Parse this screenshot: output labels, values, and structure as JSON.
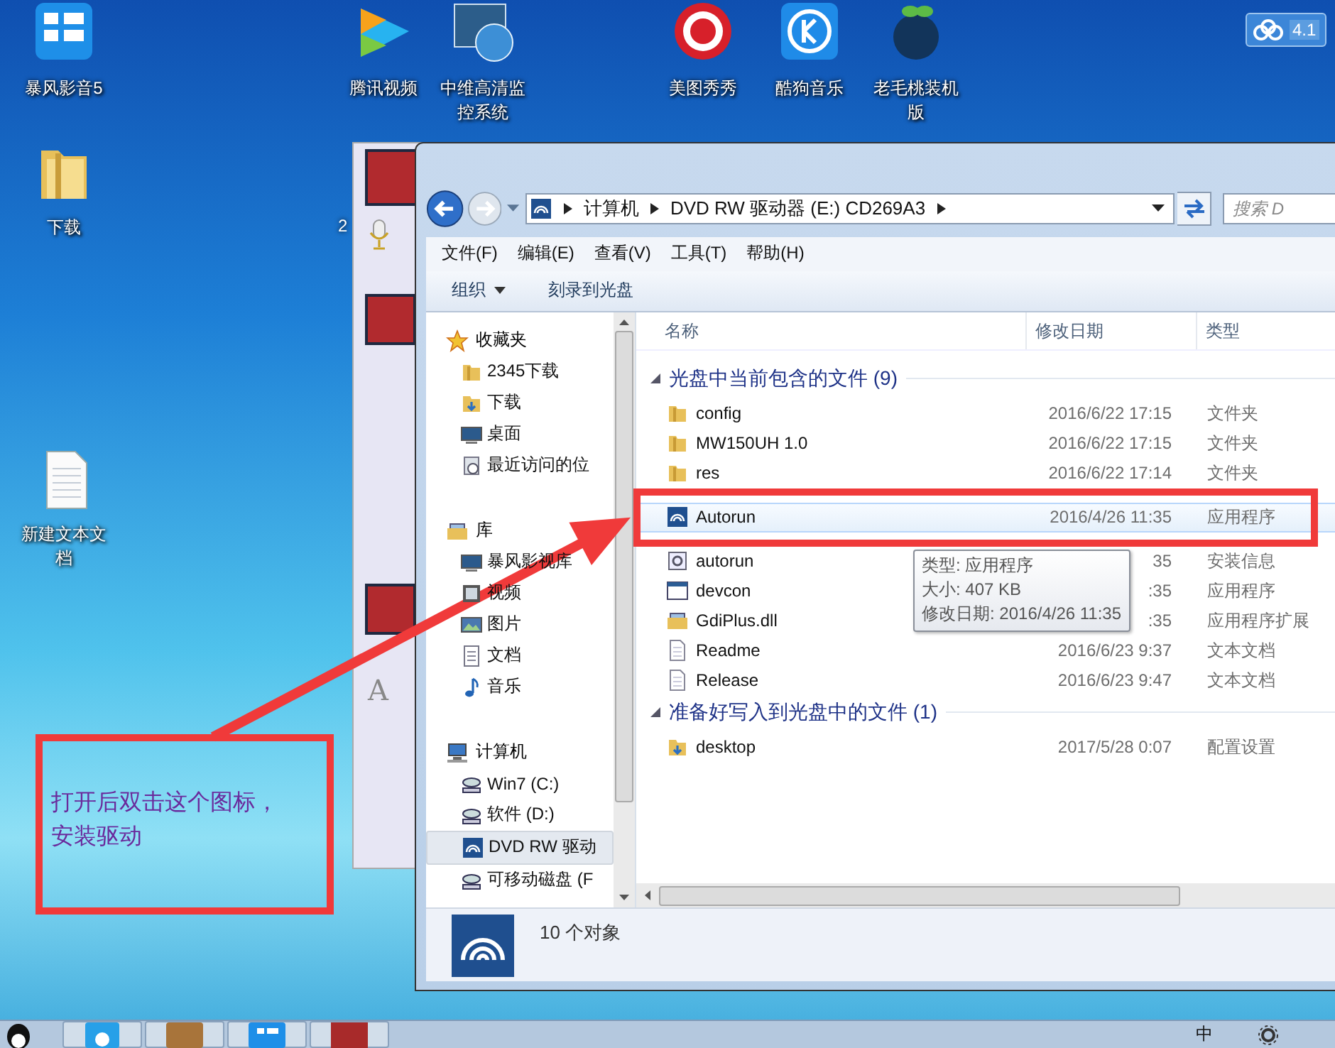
{
  "desktop_icons": [
    {
      "label": "暴风影音5",
      "kind": "player"
    },
    {
      "label": "腾讯视频",
      "kind": "video"
    },
    {
      "label": "中维高清监控系统",
      "kind": "monitor"
    },
    {
      "label": "美图秀秀",
      "kind": "photo"
    },
    {
      "label": "酷狗音乐",
      "kind": "music"
    },
    {
      "label": "老毛桃装机版",
      "kind": "tool"
    },
    {
      "label": "下载",
      "kind": "folder"
    },
    {
      "label": "新建文本文档",
      "kind": "document"
    }
  ],
  "desktop_fragment": "2",
  "widget": {
    "text": "4.1"
  },
  "chat_window": {
    "glyph": "A"
  },
  "explorer": {
    "breadcrumb": [
      "计算机",
      "DVD RW 驱动器 (E:) CD269A3"
    ],
    "search": {
      "placeholder": "搜索 D"
    },
    "menu": [
      "文件(F)",
      "编辑(E)",
      "查看(V)",
      "工具(T)",
      "帮助(H)"
    ],
    "toolbar": [
      {
        "label": "组织",
        "dropdown": true
      },
      {
        "label": "刻录到光盘",
        "dropdown": false
      }
    ],
    "nav": [
      {
        "label": "收藏夹",
        "kind": "star",
        "items": [
          {
            "label": "2345下载",
            "kind": "folder",
            "selected": false
          },
          {
            "label": "下载",
            "kind": "download",
            "selected": false
          },
          {
            "label": "桌面",
            "kind": "desktop",
            "selected": false
          },
          {
            "label": "最近访问的位",
            "kind": "recent",
            "selected": false
          }
        ]
      },
      {
        "label": "库",
        "kind": "library",
        "items": [
          {
            "label": "暴风影视库",
            "kind": "desktop",
            "selected": false
          },
          {
            "label": "视频",
            "kind": "video",
            "selected": false
          },
          {
            "label": "图片",
            "kind": "image",
            "selected": false
          },
          {
            "label": "文档",
            "kind": "doc",
            "selected": false
          },
          {
            "label": "音乐",
            "kind": "music",
            "selected": false
          }
        ]
      },
      {
        "label": "计算机",
        "kind": "computer",
        "items": [
          {
            "label": "Win7 (C:)",
            "kind": "drive",
            "selected": false
          },
          {
            "label": "软件 (D:)",
            "kind": "drive",
            "selected": false
          },
          {
            "label": "DVD RW 驱动",
            "kind": "disc",
            "selected": true
          },
          {
            "label": "可移动磁盘 (F",
            "kind": "drive",
            "selected": false
          }
        ]
      }
    ],
    "columns": [
      "名称",
      "修改日期",
      "类型"
    ],
    "groups": [
      {
        "title": "光盘中当前包含的文件 (9)",
        "expanded": true,
        "rows": [
          {
            "name": "config",
            "date": "2016/6/22 17:15",
            "type": "文件夹",
            "kind": "folder",
            "selected": false
          },
          {
            "name": "MW150UH 1.0",
            "date": "2016/6/22 17:15",
            "type": "文件夹",
            "kind": "folder",
            "selected": false
          },
          {
            "name": "res",
            "date": "2016/6/22 17:14",
            "type": "文件夹",
            "kind": "folder",
            "selected": false
          },
          {
            "name": "Autorun",
            "date": "2016/4/26 11:35",
            "type": "应用程序",
            "kind": "disc",
            "selected": true
          },
          {
            "name": "autorun",
            "date": "35",
            "type": "安装信息",
            "kind": "settings",
            "selected": false
          },
          {
            "name": "devcon",
            "date": ":35",
            "type": "应用程序",
            "kind": "program",
            "selected": false
          },
          {
            "name": "GdiPlus.dll",
            "date": ":35",
            "type": "应用程序扩展",
            "kind": "library",
            "selected": false
          },
          {
            "name": "Readme",
            "date": "2016/6/23 9:37",
            "type": "文本文档",
            "kind": "text",
            "selected": false
          },
          {
            "name": "Release",
            "date": "2016/6/23 9:47",
            "type": "文本文档",
            "kind": "text",
            "selected": false
          }
        ]
      },
      {
        "title": "准备好写入到光盘中的文件 (1)",
        "expanded": true,
        "rows": [
          {
            "name": "desktop",
            "date": "2017/5/28 0:07",
            "type": "配置设置",
            "kind": "download",
            "selected": false
          }
        ]
      }
    ],
    "tooltip": [
      "类型: 应用程序",
      "大小: 407 KB",
      "修改日期: 2016/4/26 11:35"
    ],
    "status": "10 个对象"
  },
  "annotation": {
    "text": "打开后双击这个图标，安装驱动"
  },
  "taskbar": {
    "tray": "中"
  }
}
